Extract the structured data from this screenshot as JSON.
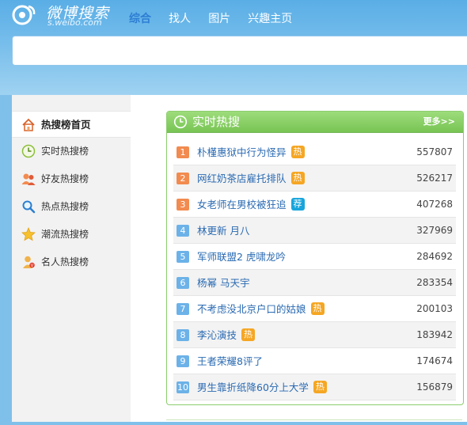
{
  "header": {
    "logo_title": "微博搜索",
    "logo_sub": "s.weibo.com",
    "nav": [
      {
        "label": "综合",
        "active": true
      },
      {
        "label": "找人",
        "active": false
      },
      {
        "label": "图片",
        "active": false
      },
      {
        "label": "兴趣主页",
        "active": false
      }
    ]
  },
  "search": {
    "value": "",
    "placeholder": ""
  },
  "sidebar": {
    "items": [
      {
        "label": "热搜榜首页",
        "icon": "home-icon",
        "active": true
      },
      {
        "label": "实时热搜榜",
        "icon": "clock-icon",
        "active": false
      },
      {
        "label": "好友热搜榜",
        "icon": "friends-icon",
        "active": false
      },
      {
        "label": "热点热搜榜",
        "icon": "search-icon",
        "active": false
      },
      {
        "label": "潮流热搜榜",
        "icon": "star-icon",
        "active": false
      },
      {
        "label": "名人热搜榜",
        "icon": "celebrity-icon",
        "active": false
      }
    ]
  },
  "panel": {
    "title": "实时热搜",
    "more": "更多>>",
    "rows": [
      {
        "rank": "1",
        "keyword": "朴槿惠狱中行为怪异",
        "badge": "热",
        "badge_type": "hot",
        "count": "557807"
      },
      {
        "rank": "2",
        "keyword": "网红奶茶店雇托排队",
        "badge": "热",
        "badge_type": "hot",
        "count": "526217"
      },
      {
        "rank": "3",
        "keyword": "女老师在男校被狂追",
        "badge": "荐",
        "badge_type": "rec",
        "count": "407268"
      },
      {
        "rank": "4",
        "keyword": "林更新 月八",
        "badge": "",
        "badge_type": "",
        "count": "327969"
      },
      {
        "rank": "5",
        "keyword": "军师联盟2 虎啸龙吟",
        "badge": "",
        "badge_type": "",
        "count": "284692"
      },
      {
        "rank": "6",
        "keyword": "杨幂 马天宇",
        "badge": "",
        "badge_type": "",
        "count": "283354"
      },
      {
        "rank": "7",
        "keyword": "不考虑没北京户口的姑娘",
        "badge": "热",
        "badge_type": "hot",
        "count": "200103"
      },
      {
        "rank": "8",
        "keyword": "李沁演技",
        "badge": "热",
        "badge_type": "hot",
        "count": "183942"
      },
      {
        "rank": "9",
        "keyword": "王者荣耀8评了",
        "badge": "",
        "badge_type": "",
        "count": "174674"
      },
      {
        "rank": "10",
        "keyword": "男生靠折纸降60分上大学",
        "badge": "热",
        "badge_type": "hot",
        "count": "156879"
      }
    ]
  },
  "colors": {
    "accent_blue": "#2d7ed3",
    "panel_green": "#78c454",
    "hot_badge": "#f5a623",
    "rec_badge": "#19a5dc",
    "rank_top": "#f28b4f",
    "rank_rest": "#6cb2e8"
  }
}
